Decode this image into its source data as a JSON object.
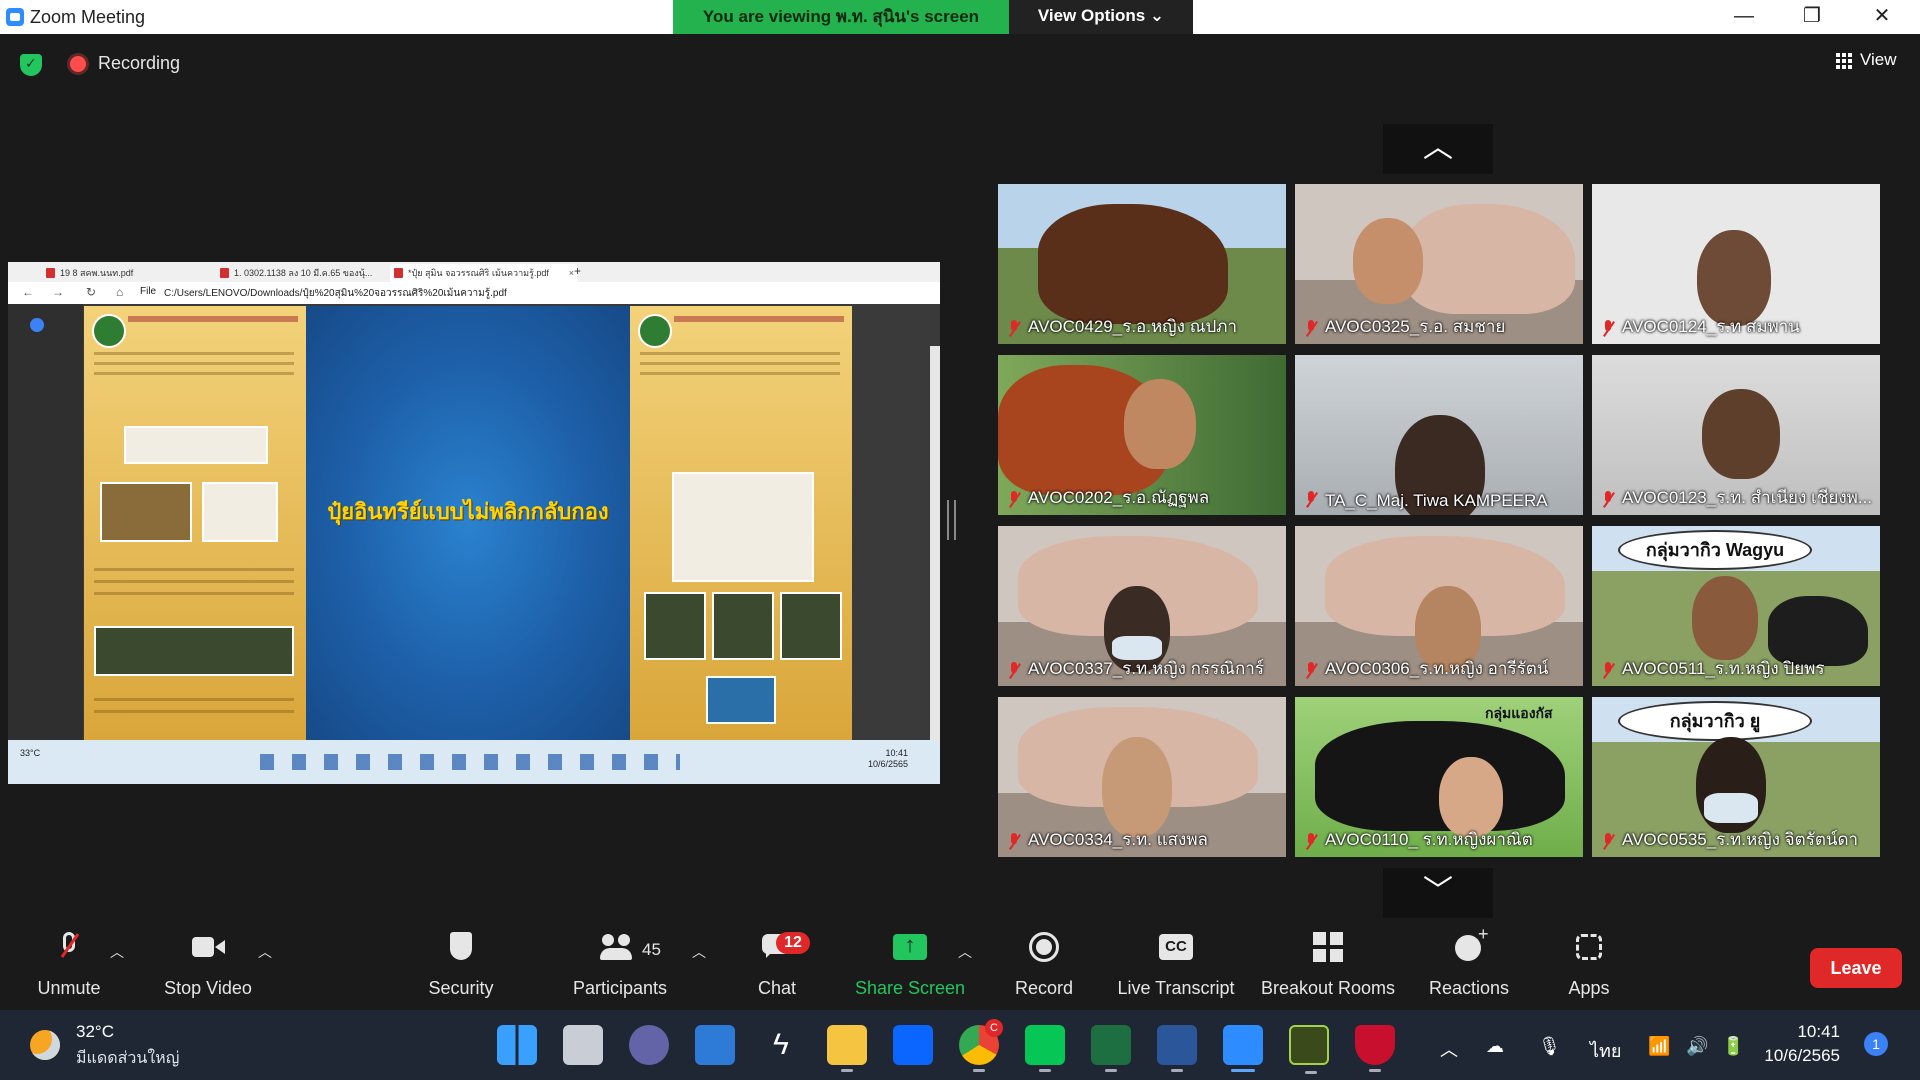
{
  "window": {
    "title": "Zoom Meeting",
    "viewing_banner": "You are viewing พ.ท. สุนิน's screen",
    "view_options": "View Options ⌄",
    "minimize": "—",
    "maximize": "❐",
    "close": "✕"
  },
  "meeting_bar": {
    "recording_label": "Recording",
    "view_label": "View"
  },
  "shared_screen": {
    "tabs": [
      {
        "label": "19 8 สคพ.นนท.pdf"
      },
      {
        "label": "1. 0302.1138 ลง 10 มี.ค.65 ของนุ้..."
      },
      {
        "label": "*ปุ๋ย สุมิน จอวรรณศิริ เม้นความรู้.pdf"
      }
    ],
    "file_label": "File",
    "url": "C:/Users/LENOVO/Downloads/ปุ๋ย%20สุมิน%20จอวรรณศิริ%20เม้นความรู้.pdf",
    "headline": "ปุ๋ยอินทรีย์แบบไม่พลิกกลับกอง",
    "taskbar_weather": "33°C",
    "taskbar_time": "10:41",
    "taskbar_date": "10/6/2565"
  },
  "gallery": {
    "up_arrow": "︿",
    "down_arrow": "﹀",
    "participants": [
      {
        "name": "AVOC0429_ร.อ.หญิง ณปภา"
      },
      {
        "name": "AVOC0325_ร.อ. สมชาย"
      },
      {
        "name": "AVOC0124_ร.ท สมพาน"
      },
      {
        "name": "AVOC0202_ร.อ.ณัฏฐพล"
      },
      {
        "name": "TA_C_Maj. Tiwa KAMPEERA"
      },
      {
        "name": "AVOC0123_ร.ท. สำเนียง เชียงพ..."
      },
      {
        "name": "AVOC0337_ร.ท.หญิง กรรณิการ์"
      },
      {
        "name": "AVOC0306_ร.ท.หญิง อารีรัตน์"
      },
      {
        "name": "AVOC0511_ร.ท.หญิง ปิยพร"
      },
      {
        "name": "AVOC0334_ร.ท. แสงพล"
      },
      {
        "name": "AVOC0110_ ร.ท.หญิงผาณิต"
      },
      {
        "name": "AVOC0535_ร.ท.หญิง จิตรัตน์ดา"
      }
    ],
    "bg_labels": {
      "wagyu": "กลุ่มวากิว Wagyu",
      "wagyu_partial": "กลุ่มวากิว  ยู",
      "angus": "กลุ่มแองกัส"
    }
  },
  "toolbar": {
    "unmute": "Unmute",
    "stop_video": "Stop Video",
    "security": "Security",
    "participants": "Participants",
    "participant_count": "45",
    "chat": "Chat",
    "chat_badge": "12",
    "share_screen": "Share Screen",
    "record": "Record",
    "live_transcript": "Live Transcript",
    "breakout_rooms": "Breakout Rooms",
    "reactions": "Reactions",
    "apps": "Apps",
    "leave": "Leave"
  },
  "taskbar": {
    "temperature": "32°C",
    "condition": "มีแดดส่วนใหญ่",
    "language": "ไทย",
    "time": "10:41",
    "date": "10/6/2565",
    "notifications": "1",
    "chrome_badge": "C"
  },
  "colors": {
    "banner_green": "#24b24e",
    "leave_red": "#e02828",
    "share_green": "#22c55e",
    "zoom_blue": "#2d8cff"
  }
}
